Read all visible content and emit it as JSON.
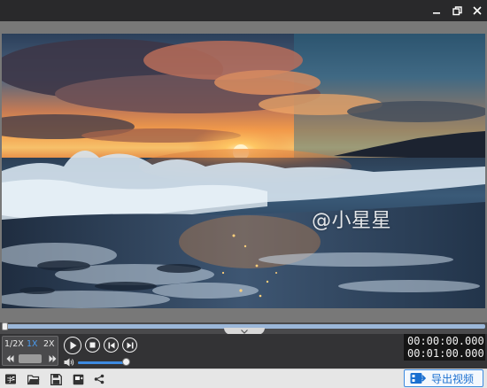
{
  "window": {
    "controls": {
      "minimize_icon": "minimize-icon",
      "maximize_icon": "restore-icon",
      "close_icon": "close-icon"
    }
  },
  "video": {
    "scene": "ocean-sunset-beach-waves",
    "watermark": "@小星星"
  },
  "timeline": {
    "progress": 0.0,
    "collapse_icon": "chevron-down-icon"
  },
  "speed": {
    "options": [
      "1/2X",
      "1X",
      "2X"
    ],
    "selected": "1X",
    "slow_icon": "rewind-icon",
    "fast_icon": "fast-forward-icon"
  },
  "playback": {
    "play_icon": "play-icon",
    "stop_icon": "stop-icon",
    "prev_icon": "previous-frame-icon",
    "next_icon": "next-frame-icon"
  },
  "volume": {
    "level": 0.95,
    "icon": "volume-icon"
  },
  "time": {
    "current": "00:00:00.000",
    "total": "00:01:00.000"
  },
  "toolbar": {
    "tools": [
      "subtitle-icon",
      "folder-open-icon",
      "save-icon",
      "export-frame-icon",
      "share-icon"
    ],
    "export_label": "导出视频",
    "export_icon": "export-video-icon"
  },
  "colors": {
    "accent": "#3d8ae0",
    "titlebar": "#29292b",
    "panel": "#333335",
    "toolbar": "#e6e6e6"
  }
}
